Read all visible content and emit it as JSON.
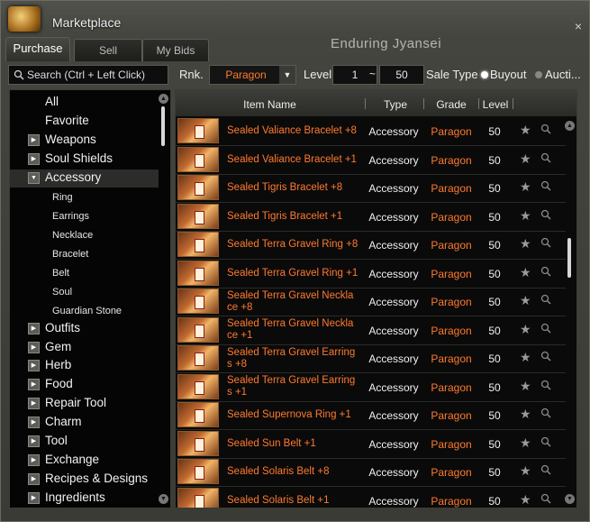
{
  "window": {
    "title": "Marketplace",
    "subtitle": "Enduring Jyansei",
    "close_label": "×"
  },
  "tabs": [
    {
      "label": "Purchase",
      "active": true
    },
    {
      "label": "Sell",
      "active": false
    },
    {
      "label": "My Bids",
      "active": false
    }
  ],
  "filters": {
    "search_placeholder": "Search (Ctrl + Left Click)",
    "rank_label": "Rnk.",
    "rank_value": "Paragon",
    "level_label": "Level",
    "level_min": "1",
    "level_sep": "~",
    "level_max": "50",
    "sale_type_label": "Sale Type",
    "buyout_label": "Buyout",
    "auction_label": "Aucti..."
  },
  "categories": [
    {
      "label": "All",
      "expandable": false
    },
    {
      "label": "Favorite",
      "expandable": false
    },
    {
      "label": "Weapons",
      "expandable": true
    },
    {
      "label": "Soul Shields",
      "expandable": true
    },
    {
      "label": "Accessory",
      "expandable": true,
      "expanded": true,
      "selected": true,
      "children": [
        "Ring",
        "Earrings",
        "Necklace",
        "Bracelet",
        "Belt",
        "Soul",
        "Guardian Stone"
      ]
    },
    {
      "label": "Outfits",
      "expandable": true
    },
    {
      "label": "Gem",
      "expandable": true
    },
    {
      "label": "Herb",
      "expandable": true
    },
    {
      "label": "Food",
      "expandable": true
    },
    {
      "label": "Repair Tool",
      "expandable": true
    },
    {
      "label": "Charm",
      "expandable": true
    },
    {
      "label": "Tool",
      "expandable": true
    },
    {
      "label": "Exchange",
      "expandable": true
    },
    {
      "label": "Recipes & Designs",
      "expandable": true
    },
    {
      "label": "Ingredients",
      "expandable": true
    }
  ],
  "table": {
    "headers": {
      "name": "Item Name",
      "type": "Type",
      "grade": "Grade",
      "level": "Level"
    },
    "rows": [
      {
        "name": [
          "Sealed Valiance Bracelet +8"
        ],
        "type": "Accessory",
        "grade": "Paragon",
        "level": "50"
      },
      {
        "name": [
          "Sealed Valiance Bracelet +1"
        ],
        "type": "Accessory",
        "grade": "Paragon",
        "level": "50"
      },
      {
        "name": [
          "Sealed Tigris Bracelet +8"
        ],
        "type": "Accessory",
        "grade": "Paragon",
        "level": "50"
      },
      {
        "name": [
          "Sealed Tigris Bracelet +1"
        ],
        "type": "Accessory",
        "grade": "Paragon",
        "level": "50"
      },
      {
        "name": [
          "Sealed Terra Gravel Ring +8"
        ],
        "type": "Accessory",
        "grade": "Paragon",
        "level": "50"
      },
      {
        "name": [
          "Sealed Terra Gravel Ring +1"
        ],
        "type": "Accessory",
        "grade": "Paragon",
        "level": "50"
      },
      {
        "name": [
          "Sealed Terra Gravel Neckla",
          "ce +8"
        ],
        "type": "Accessory",
        "grade": "Paragon",
        "level": "50"
      },
      {
        "name": [
          "Sealed Terra Gravel Neckla",
          "ce +1"
        ],
        "type": "Accessory",
        "grade": "Paragon",
        "level": "50"
      },
      {
        "name": [
          "Sealed Terra Gravel Earring",
          "s +8"
        ],
        "type": "Accessory",
        "grade": "Paragon",
        "level": "50"
      },
      {
        "name": [
          "Sealed Terra Gravel Earring",
          "s +1"
        ],
        "type": "Accessory",
        "grade": "Paragon",
        "level": "50"
      },
      {
        "name": [
          "Sealed Supernova Ring +1"
        ],
        "type": "Accessory",
        "grade": "Paragon",
        "level": "50"
      },
      {
        "name": [
          "Sealed Sun Belt +1"
        ],
        "type": "Accessory",
        "grade": "Paragon",
        "level": "50"
      },
      {
        "name": [
          "Sealed Solaris Belt +8"
        ],
        "type": "Accessory",
        "grade": "Paragon",
        "level": "50"
      },
      {
        "name": [
          "Sealed Solaris Belt +1"
        ],
        "type": "Accessory",
        "grade": "Paragon",
        "level": "50"
      }
    ]
  },
  "icons": {
    "favorite": "star-icon",
    "preview": "magnifier-icon",
    "search": "search-icon"
  }
}
